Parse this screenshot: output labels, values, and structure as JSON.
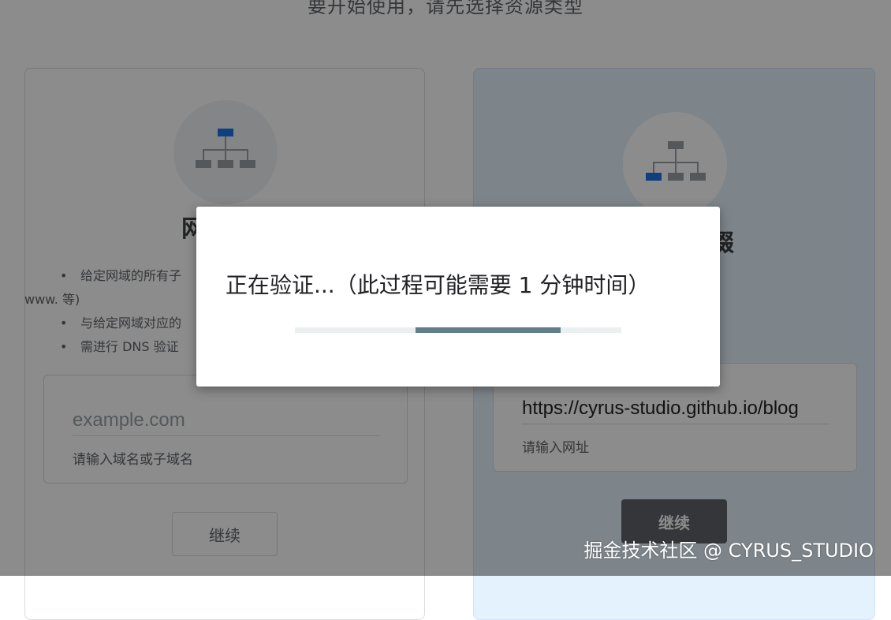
{
  "page": {
    "heading": "要开始使用，请先选择资源类型"
  },
  "domain_card": {
    "title": "网域",
    "bullets": [
      "给定网域的所有子",
      "www. 等)",
      "与给定网域对应的",
      "需进行 DNS 验证"
    ],
    "input": {
      "value": "",
      "placeholder": "example.com",
      "help": "请输入域名或子域名"
    },
    "button": "继续"
  },
  "url_card": {
    "title": "缀",
    "input": {
      "value": "https://cyrus-studio.github.io/blog",
      "placeholder": "",
      "help": "请输入网址"
    },
    "button": "继续"
  },
  "dialog": {
    "message": "正在验证...（此过程可能需要 1 分钟时间）",
    "progress": {
      "start": 0.37,
      "end": 0.815
    }
  },
  "watermark": "掘金技术社区 @ CYRUS_STUDIO",
  "colors": {
    "accent": "#1a73e8",
    "progress": "#607d8b",
    "selected_card": "#e3f2fd"
  },
  "icons": {
    "domain": "sitemap-icon",
    "url": "sitemap-icon"
  }
}
